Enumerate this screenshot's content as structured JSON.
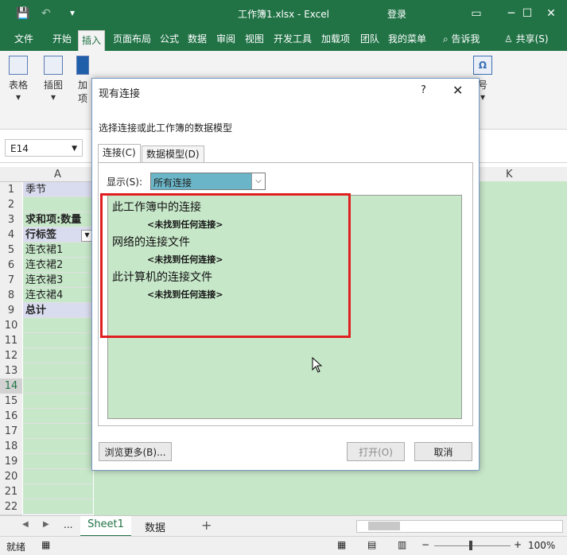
{
  "titlebar": {
    "filename": "工作簿1.xlsx  -  Excel",
    "login": "登录",
    "quick_access": [
      "💾",
      "↶",
      "▾"
    ]
  },
  "ribbon_tabs": [
    "文件",
    "开始",
    "插入",
    "页面布局",
    "公式",
    "数据",
    "审阅",
    "视图",
    "开发工具",
    "加载项",
    "团队",
    "我的菜单",
    "告诉我",
    "共享(S)"
  ],
  "ribbon_groups": {
    "table": "表格",
    "illustrations": "插图",
    "addins": "加\n项",
    "symbols": "号"
  },
  "name_box": "E14",
  "columns": {
    "a": "A",
    "k": "K"
  },
  "rows": [
    {
      "num": "1",
      "a": "季节",
      "bold": false,
      "hdr": true
    },
    {
      "num": "2",
      "a": "",
      "bold": false
    },
    {
      "num": "3",
      "a": "求和项:数量",
      "bold": true
    },
    {
      "num": "4",
      "a": "行标签",
      "bold": true,
      "hdr": true,
      "filter": true
    },
    {
      "num": "5",
      "a": "连衣裙1",
      "bold": false
    },
    {
      "num": "6",
      "a": "连衣裙2",
      "bold": false
    },
    {
      "num": "7",
      "a": "连衣裙3",
      "bold": false
    },
    {
      "num": "8",
      "a": "连衣裙4",
      "bold": false
    },
    {
      "num": "9",
      "a": "总计",
      "bold": true,
      "hdr": true
    },
    {
      "num": "10",
      "a": ""
    },
    {
      "num": "11",
      "a": ""
    },
    {
      "num": "12",
      "a": ""
    },
    {
      "num": "13",
      "a": ""
    },
    {
      "num": "14",
      "a": ""
    },
    {
      "num": "15",
      "a": ""
    },
    {
      "num": "16",
      "a": ""
    },
    {
      "num": "17",
      "a": ""
    },
    {
      "num": "18",
      "a": ""
    },
    {
      "num": "19",
      "a": ""
    },
    {
      "num": "20",
      "a": ""
    },
    {
      "num": "21",
      "a": ""
    },
    {
      "num": "22",
      "a": ""
    }
  ],
  "sheet_tabs": {
    "ellipsis": "...",
    "sheet1": "Sheet1",
    "sheet2": "数据",
    "add": "+"
  },
  "status": {
    "ready": "就绪",
    "zoom": "100%"
  },
  "dialog": {
    "title": "现有连接",
    "help": "?",
    "close": "✕",
    "prompt": "选择连接或此工作簿的数据模型",
    "tab_connections": "连接(C)",
    "tab_datamodel": "数据模型(D)",
    "show_label": "显示(S):",
    "show_value": "所有连接",
    "groups": [
      {
        "title": "此工作簿中的连接",
        "empty": "<未找到任何连接>"
      },
      {
        "title": "网络的连接文件",
        "empty": "<未找到任何连接>"
      },
      {
        "title": "此计算机的连接文件",
        "empty": "<未找到任何连接>"
      }
    ],
    "browse_button": "浏览更多(B)...",
    "open_button": "打开(O)",
    "cancel_button": "取消"
  },
  "colors": {
    "excel_green": "#217346",
    "highlight": "#e02020",
    "list_bg": "#c7e7c9"
  }
}
